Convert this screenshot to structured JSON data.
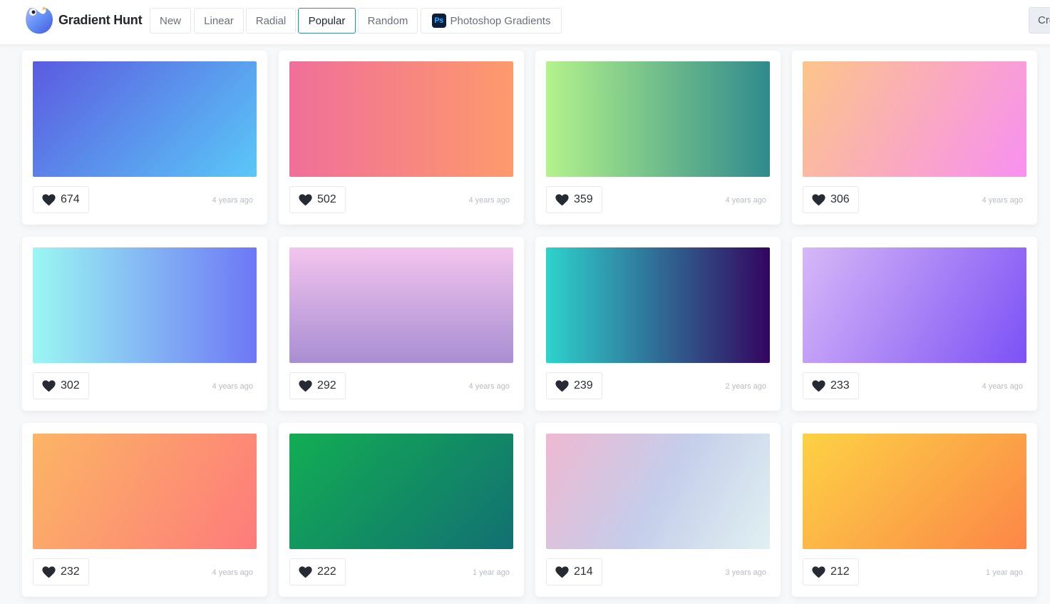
{
  "header": {
    "brand": "Gradient Hunt",
    "nav": [
      {
        "label": "New"
      },
      {
        "label": "Linear"
      },
      {
        "label": "Radial"
      },
      {
        "label": "Popular",
        "active": true
      },
      {
        "label": "Random"
      },
      {
        "label": "Photoshop Gradients",
        "icon": "photoshop-icon",
        "icon_text": "Ps"
      }
    ],
    "create_label": "Create"
  },
  "gradients": [
    {
      "likes": "674",
      "time": "4 years ago",
      "colors": [
        "#5b5be0",
        "#5ac8f7"
      ]
    },
    {
      "likes": "502",
      "time": "4 years ago",
      "colors": [
        "#f06f9a",
        "#fd9a6c"
      ]
    },
    {
      "likes": "359",
      "time": "4 years ago",
      "colors": [
        "#b4f28c",
        "#2f8a8c"
      ]
    },
    {
      "likes": "306",
      "time": "4 years ago",
      "colors": [
        "#fcc58a",
        "#f890f2"
      ]
    },
    {
      "likes": "302",
      "time": "4 years ago",
      "colors": [
        "#9bf7f2",
        "#6e77f6"
      ]
    },
    {
      "likes": "292",
      "time": "4 years ago",
      "colors": [
        "#f3c4ee",
        "#a88ed2"
      ]
    },
    {
      "likes": "239",
      "time": "2 years ago",
      "colors": [
        "#2ed3cc",
        "#33055f"
      ]
    },
    {
      "likes": "233",
      "time": "4 years ago",
      "colors": [
        "#d7b8f7",
        "#7c51f6"
      ]
    },
    {
      "likes": "232",
      "time": "4 years ago",
      "colors": [
        "#fcb565",
        "#fd7b7b"
      ]
    },
    {
      "likes": "222",
      "time": "1 year ago",
      "colors": [
        "#12ad53",
        "#127072"
      ]
    },
    {
      "likes": "214",
      "time": "3 years ago",
      "colors": [
        "#efb9d1",
        "#c5cdea",
        "#e0f1f1"
      ]
    },
    {
      "likes": "212",
      "time": "1 year ago",
      "colors": [
        "#fdd244",
        "#fc8648"
      ]
    }
  ],
  "icons": {
    "like": "heart-icon",
    "logo": "gradient-hunt-logo"
  }
}
